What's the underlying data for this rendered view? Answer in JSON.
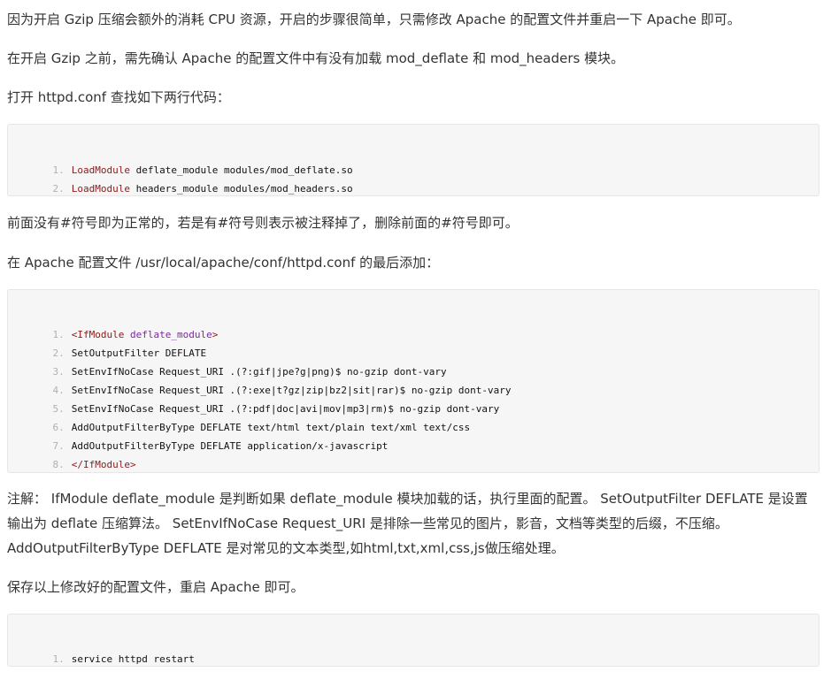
{
  "paragraphs": {
    "p1": "因为开启 Gzip 压缩会额外的消耗 CPU 资源，开启的步骤很简单，只需修改 Apache 的配置文件并重启一下 Apache 即可。",
    "p2": "在开启 Gzip 之前，需先确认 Apache 的配置文件中有没有加载 mod_deflate 和 mod_headers 模块。",
    "p3": "打开 httpd.conf 查找如下两行代码：",
    "p4": "前面没有#符号即为正常的，若是有#符号则表示被注释掉了，删除前面的#符号即可。",
    "p5": "在 Apache 配置文件 /usr/local/apache/conf/httpd.conf 的最后添加：",
    "p6": "注解： IfModule deflate_module 是判断如果 deflate_module 模块加载的话，执行里面的配置。 SetOutputFilter DEFLATE 是设置输出为 deflate 压缩算法。 SetEnvIfNoCase Request_URI 是排除一些常见的图片，影音，文档等类型的后缀，不压缩。AddOutputFilterByType DEFLATE 是对常见的文本类型,如html,txt,xml,css,js做压缩处理。",
    "p7": "保存以上修改好的配置文件，重启 Apache 即可。"
  },
  "code_block_1": {
    "lines": [
      {
        "num": "1.",
        "keyword": "LoadModule",
        "rest": " deflate_module modules/mod_deflate.so"
      },
      {
        "num": "2.",
        "keyword": "LoadModule",
        "rest": " headers_module modules/mod_headers.so"
      }
    ]
  },
  "code_block_2": {
    "lines": [
      {
        "num": "1.",
        "tag_open": "<IfModule",
        "tag_arg": " deflate_module",
        "tag_close": ">"
      },
      {
        "num": "2.",
        "text": "SetOutputFilter DEFLATE"
      },
      {
        "num": "3.",
        "text": "SetEnvIfNoCase Request_URI .(?:gif|jpe?g|png)$ no-gzip dont-vary"
      },
      {
        "num": "4.",
        "text": "SetEnvIfNoCase Request_URI .(?:exe|t?gz|zip|bz2|sit|rar)$ no-gzip dont-vary"
      },
      {
        "num": "5.",
        "text": "SetEnvIfNoCase Request_URI .(?:pdf|doc|avi|mov|mp3|rm)$ no-gzip dont-vary"
      },
      {
        "num": "6.",
        "text": "AddOutputFilterByType DEFLATE text/html text/plain text/xml text/css"
      },
      {
        "num": "7.",
        "text": "AddOutputFilterByType DEFLATE application/x-javascript"
      },
      {
        "num": "8.",
        "tag_end": "</IfModule>"
      }
    ]
  },
  "code_block_3": {
    "lines": [
      {
        "num": "1.",
        "text": "service httpd restart"
      }
    ]
  },
  "colors": {
    "keyword": "#8b1a1a",
    "tag": "#7a2a9a",
    "line_number": "#b0b0b0",
    "code_bg": "#f6f6f6"
  }
}
